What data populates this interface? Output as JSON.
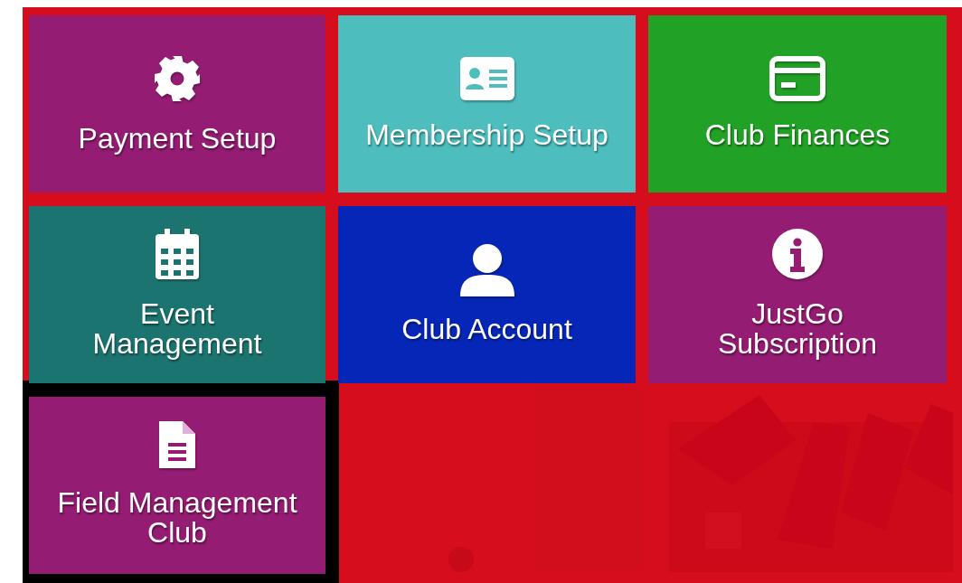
{
  "tiles": [
    {
      "lines": [
        "Payment Setup"
      ],
      "kind": "gear",
      "color": "#951c73",
      "highlighted": false
    },
    {
      "lines": [
        "Membership Setup"
      ],
      "kind": "id-card",
      "color": "#4dbdbd",
      "highlighted": false
    },
    {
      "lines": [
        "Club Finances"
      ],
      "kind": "credit-card",
      "color": "#21a226",
      "highlighted": false
    },
    {
      "lines": [
        "Event",
        "Management"
      ],
      "kind": "calendar",
      "color": "#1c7470",
      "highlighted": false
    },
    {
      "lines": [
        "Club Account"
      ],
      "kind": "user",
      "color": "#0626b8",
      "highlighted": false
    },
    {
      "lines": [
        "JustGo",
        "Subscription"
      ],
      "kind": "info",
      "color": "#951c73",
      "highlighted": false
    },
    {
      "lines": [
        "Field Management",
        "Club"
      ],
      "kind": "document",
      "color": "#951c73",
      "highlighted": true
    }
  ]
}
